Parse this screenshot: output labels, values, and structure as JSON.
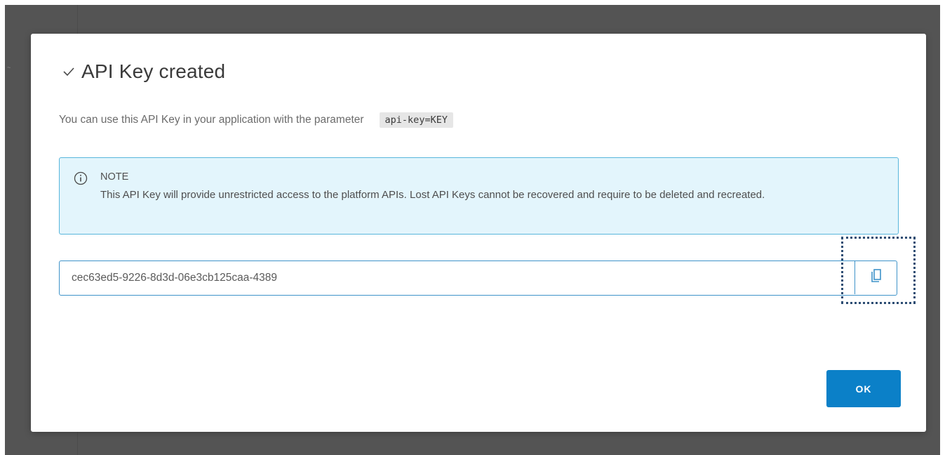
{
  "dialog": {
    "title": "API Key created",
    "description": "You can use this API Key in your application with the parameter",
    "parameter_code": "api-key=KEY",
    "note": {
      "heading": "NOTE",
      "text": "This API Key will provide unrestricted access to the platform APIs. Lost API Keys cannot be recovered and require to be deleted and recreated."
    },
    "api_key_value": "cec63ed5-9226-8d3d-06e3cb125caa-4389",
    "ok_label": "OK"
  },
  "icons": {
    "title": "check-icon",
    "note": "info-icon",
    "copy": "copy-icon"
  },
  "colors": {
    "backdrop": "#545454",
    "note_background": "#e3f5fc",
    "note_border": "#58b6dc",
    "field_border": "#3e93c9",
    "primary_button": "#0b80c8"
  }
}
